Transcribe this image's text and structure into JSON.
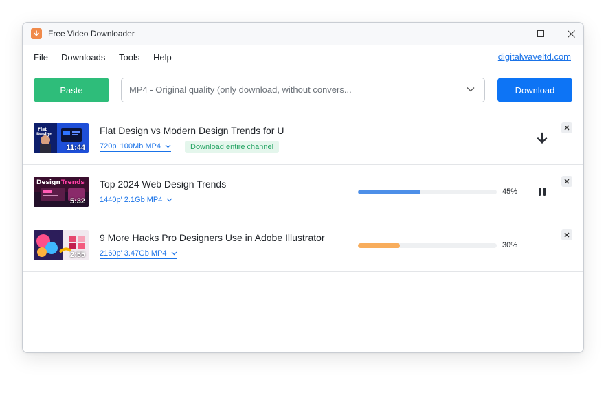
{
  "app": {
    "title": "Free Video Downloader",
    "accent": "#f08a4b"
  },
  "menu": {
    "file": "File",
    "downloads": "Downloads",
    "tools": "Tools",
    "help": "Help",
    "site_link": "digitalwaveltd.com"
  },
  "toolbar": {
    "paste_label": "Paste",
    "format_value": "MP4 - Original quality (only download, without convers...",
    "download_label": "Download"
  },
  "downloads": [
    {
      "title": "Flat Design vs Modern Design Trends for U",
      "meta": "720p' 100Mb MP4",
      "badge": "Download entire channel",
      "duration": "11:44",
      "status": "queued",
      "action_icon": "download-arrow-icon"
    },
    {
      "title": "Top 2024 Web Design Trends",
      "meta": "1440p' 2.1Gb MP4",
      "duration": "5:32",
      "progress": 45,
      "progress_label": "45%",
      "progress_color": "#4d8fe8",
      "action_icon": "pause-icon"
    },
    {
      "title": "9 More Hacks Pro Designers Use in Adobe Illustrator",
      "meta": "2160p' 3.47Gb MP4",
      "duration": "2:55",
      "progress": 30,
      "progress_label": "30%",
      "progress_color": "#f8ad5c"
    }
  ]
}
